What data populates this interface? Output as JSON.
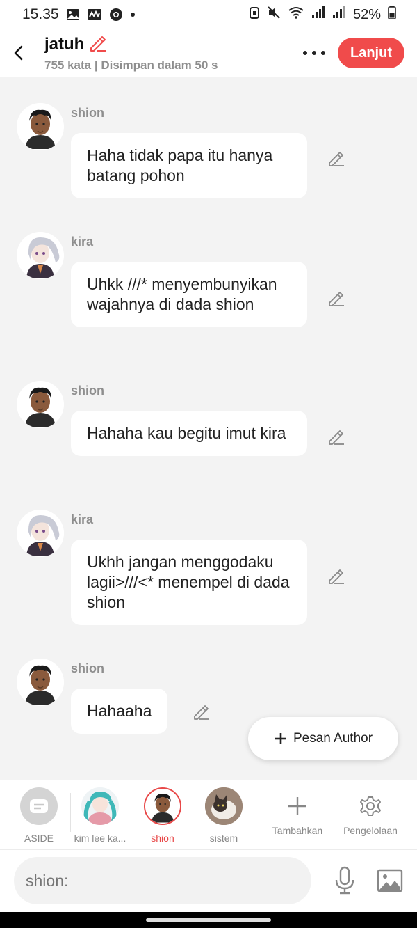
{
  "status_bar": {
    "time": "15.35",
    "battery": "52%"
  },
  "header": {
    "title": "jatuh",
    "subtitle": "755 kata | Disimpan dalam 50 s",
    "next_button": "Lanjut"
  },
  "messages": [
    {
      "sender": "shion",
      "text": "Haha tidak papa itu hanya batang pohon"
    },
    {
      "sender": "kira",
      "text": "Uhkk ///* menyembunyikan wajahnya di dada shion"
    },
    {
      "sender": "shion",
      "text": "Hahaha kau begitu imut kira"
    },
    {
      "sender": "kira",
      "text": "Ukhh jangan menggodaku lagii>///<* menempel di dada shion"
    },
    {
      "sender": "shion",
      "text": "Hahaaha"
    }
  ],
  "pesan_author": "Pesan Author",
  "characters": [
    {
      "label": "ASIDE",
      "icon": "aside-icon"
    },
    {
      "label": "kim lee ka..."
    },
    {
      "label": "shion",
      "active": true
    },
    {
      "label": "sistem"
    }
  ],
  "actions": {
    "add": "Tambahkan",
    "manage": "Pengelolaan"
  },
  "input": {
    "placeholder": "shion:"
  },
  "colors": {
    "accent": "#f04b4b",
    "background": "#f3f3f3"
  }
}
